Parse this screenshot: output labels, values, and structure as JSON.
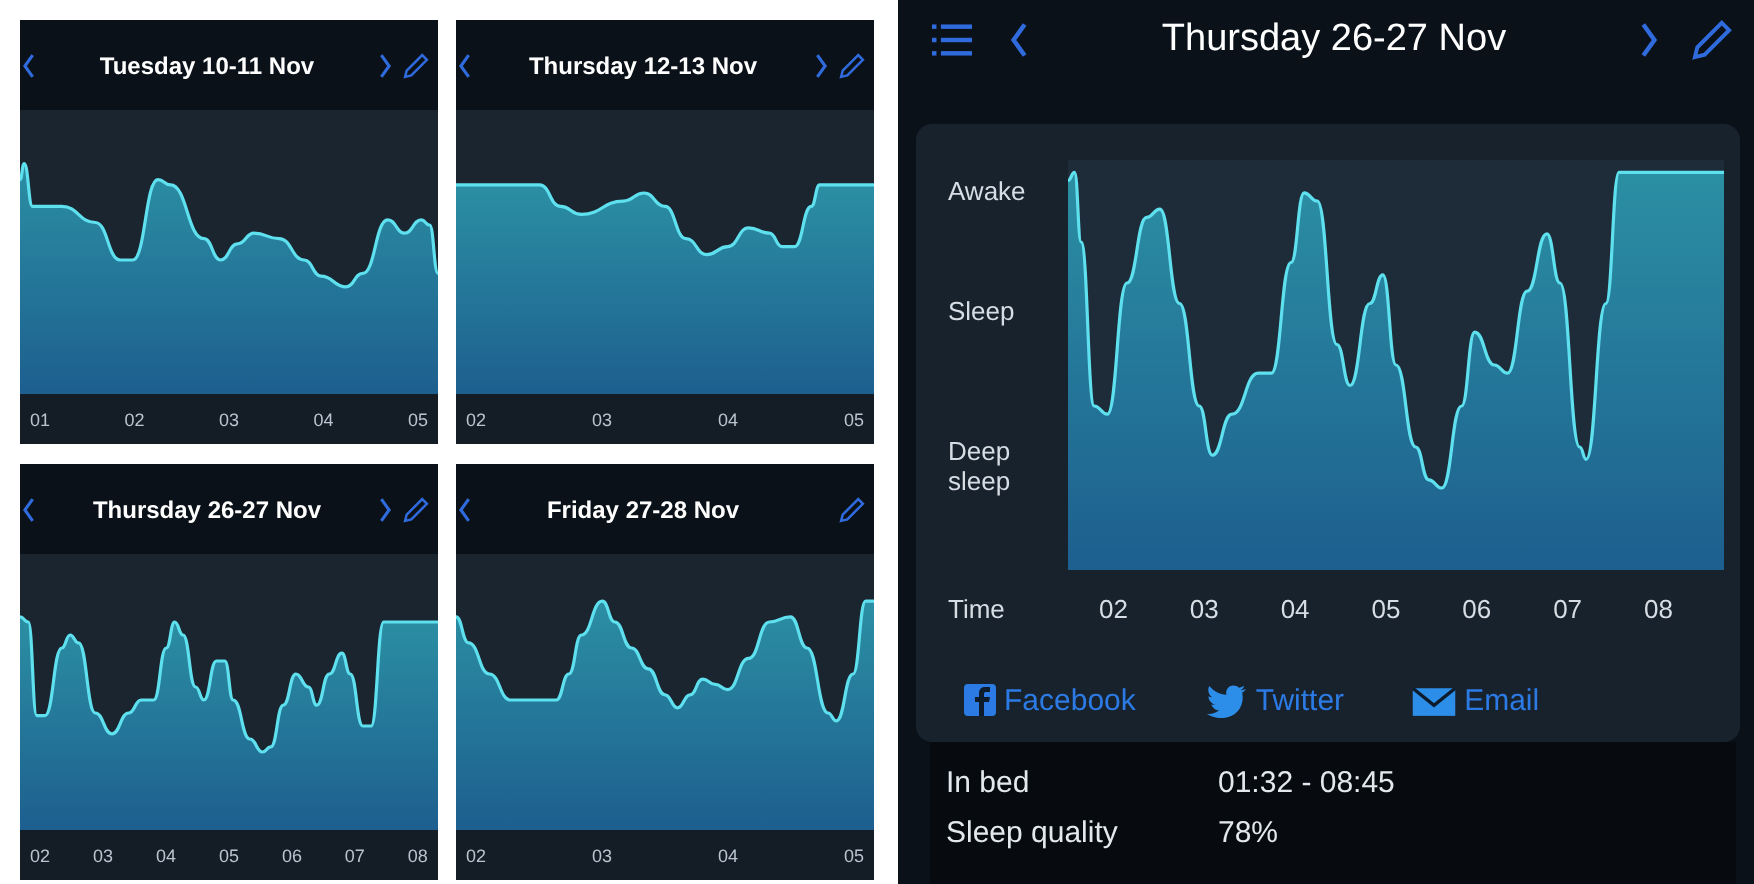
{
  "panels": [
    {
      "title": "Tuesday 10-11 Nov",
      "next_arrow": true,
      "ticks": [
        "01",
        "02",
        "03",
        "04",
        "05"
      ]
    },
    {
      "title": "Thursday 12-13 Nov",
      "next_arrow": true,
      "ticks": [
        "02",
        "03",
        "04",
        "05"
      ]
    },
    {
      "title": "Thursday 26-27 Nov",
      "next_arrow": true,
      "ticks": [
        "02",
        "03",
        "04",
        "05",
        "06",
        "07",
        "08"
      ]
    },
    {
      "title": "Friday 27-28 Nov",
      "next_arrow": false,
      "ticks": [
        "02",
        "03",
        "04",
        "05"
      ]
    }
  ],
  "detail": {
    "title": "Thursday 26-27 Nov",
    "y_labels": [
      "Awake",
      "Sleep",
      "Deep sleep"
    ],
    "axis_label": "Time",
    "ticks": [
      "02",
      "03",
      "04",
      "05",
      "06",
      "07",
      "08"
    ],
    "share": [
      {
        "kind": "facebook",
        "label": "Facebook"
      },
      {
        "kind": "twitter",
        "label": "Twitter"
      },
      {
        "kind": "email",
        "label": "Email"
      }
    ],
    "stats": [
      {
        "label": "In bed",
        "value": "01:32 - 08:45"
      },
      {
        "label": "Sleep quality",
        "value": "78%"
      }
    ]
  }
}
